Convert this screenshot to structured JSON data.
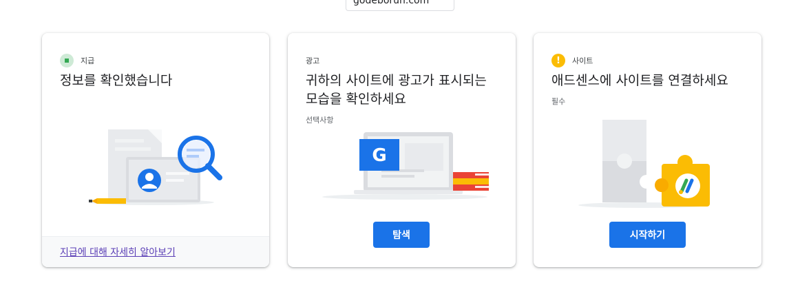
{
  "header": {
    "domain": "godeborun.com"
  },
  "cards": [
    {
      "tag": "지급",
      "title": "정보를 확인했습니다",
      "footer_link": "지급에 대해 자세히 알아보기",
      "icon": "check-status-icon"
    },
    {
      "tag": "광고",
      "title_line1": "귀하의 사이트에 광고가 표시되는",
      "title_line2": "모습을 확인하세요",
      "subtitle": "선택사항",
      "button": "탐색"
    },
    {
      "tag": "사이트",
      "title": "애드센스에 사이트를 연결하세요",
      "subtitle": "필수",
      "button": "시작하기",
      "warn_symbol": "!"
    }
  ],
  "colors": {
    "primary": "#1a73e8",
    "warning": "#fbbc04",
    "success": "#34a853",
    "link_visited": "#5b3fb6"
  }
}
